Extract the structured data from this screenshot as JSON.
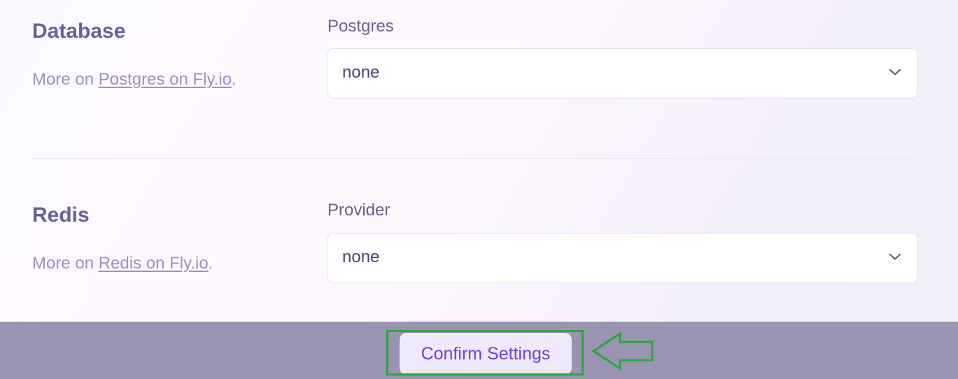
{
  "database": {
    "title": "Database",
    "desc_prefix": "More on ",
    "link_text": "Postgres on Fly.io",
    "desc_suffix": ".",
    "field_label": "Postgres",
    "select_value": "none"
  },
  "redis": {
    "title": "Redis",
    "desc_prefix": "More on ",
    "link_text": "Redis on Fly.io",
    "desc_suffix": ".",
    "field_label": "Provider",
    "select_value": "none"
  },
  "footer": {
    "confirm_label": "Confirm Settings"
  },
  "icons": {
    "chevron": "chevron-down-icon",
    "annotation_arrow": "left-arrow-icon"
  },
  "colors": {
    "title": "#6a5f9a",
    "muted_text": "#9d90c6",
    "button_text": "#6e3fd6",
    "footer_bg": "#9a93b2",
    "highlight": "#29a83a"
  }
}
